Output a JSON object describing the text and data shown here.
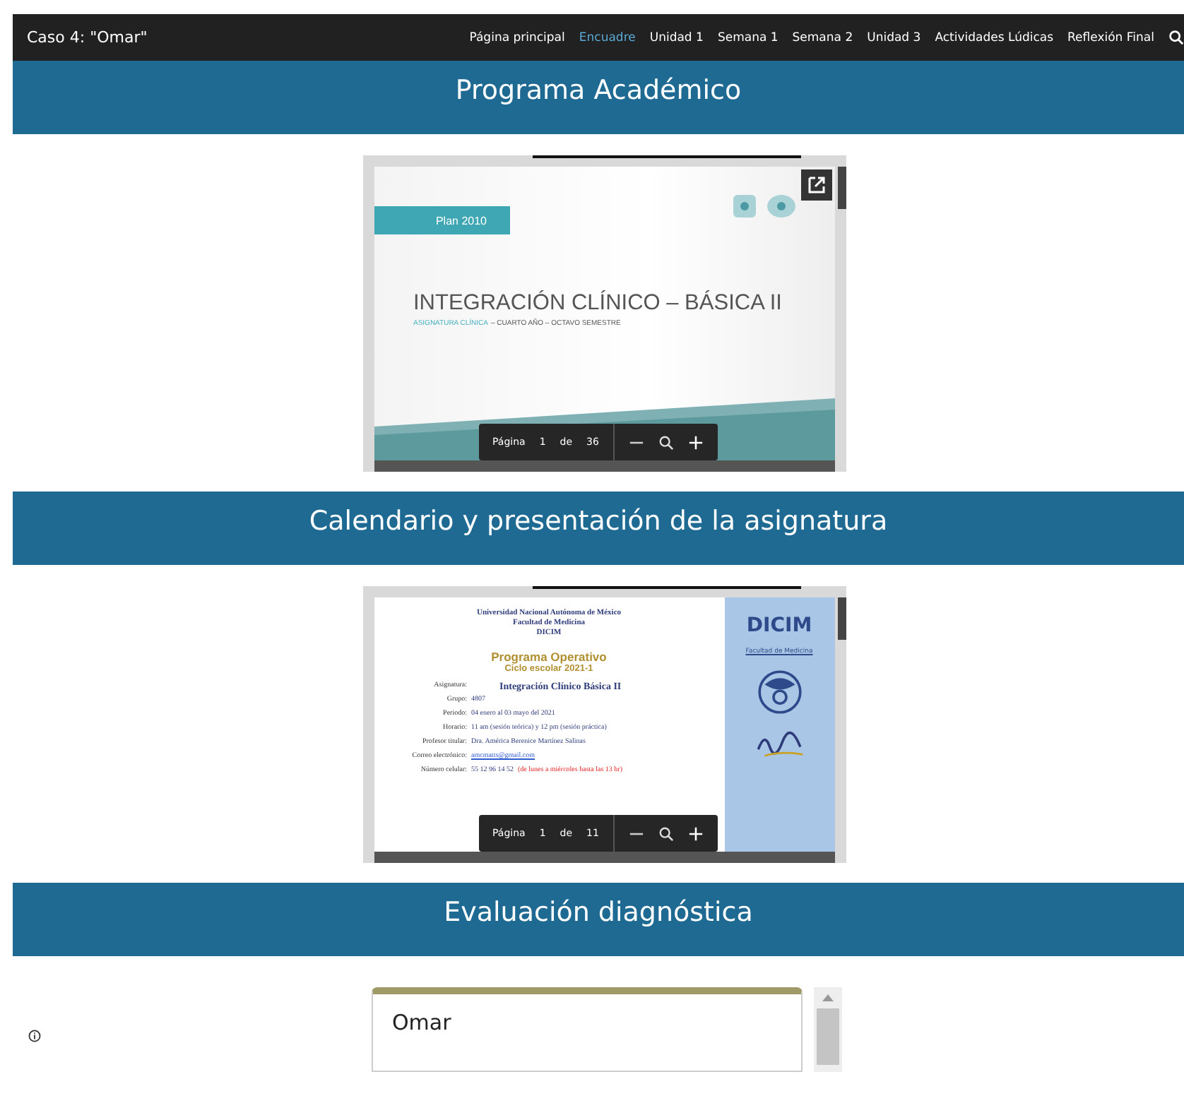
{
  "site_title": "Caso 4: \"Omar\"",
  "nav": [
    {
      "label": "Página principal",
      "selected": false
    },
    {
      "label": "Encuadre",
      "selected": true
    },
    {
      "label": "Unidad 1",
      "selected": false
    },
    {
      "label": "Semana 1",
      "selected": false
    },
    {
      "label": "Semana 2",
      "selected": false
    },
    {
      "label": "Unidad 3",
      "selected": false
    },
    {
      "label": "Actividades Lúdicas",
      "selected": false
    },
    {
      "label": "Reflexión Final",
      "selected": false
    }
  ],
  "sections": [
    {
      "heading": "Programa Académico",
      "viewer": {
        "kind": "slide",
        "page": "1",
        "of_label": "de",
        "page_label": "Página",
        "total": "36",
        "slide": {
          "badge": "Plan 2010",
          "title": "INTEGRACIÓN CLÍNICO – BÁSICA II",
          "subtitle_accent": "ASIGNATURA CLÍNICA",
          "subtitle_rest": "– CUARTO AÑO – OCTAVO SEMESTRE"
        }
      }
    },
    {
      "heading": "Calendario y presentación de la asignatura",
      "viewer": {
        "kind": "document",
        "page": "1",
        "of_label": "de",
        "page_label": "Página",
        "total": "11",
        "doc": {
          "header": [
            "Universidad Nacional Autónoma de México",
            "Facultad de Medicina",
            "DICIM"
          ],
          "title": "Programa Operativo",
          "cycle": "Ciclo escolar 2021-1",
          "fields": [
            {
              "label": "Asignatura:",
              "value": "Integración Clínico Básica II",
              "kind": "heading"
            },
            {
              "label": "Grupo:",
              "value": "4807",
              "kind": "plain"
            },
            {
              "label": "Periodo:",
              "value": "04 enero al 03 mayo del 2021",
              "kind": "plain"
            },
            {
              "label": "Horario:",
              "value": "11 am (sesión teórica) y 12 pm (sesión práctica)",
              "kind": "plain"
            },
            {
              "label": "Profesor titular:",
              "value": "Dra. América Berenice Martínez Salinas",
              "kind": "plain"
            },
            {
              "label": "Correo electrónico:",
              "value": "amcmatts@gmail.com",
              "kind": "link"
            },
            {
              "label": "Número celular:",
              "value": "55 12 96 14 52",
              "note": "(de lunes a miércoles hasta las 13 hr)",
              "kind": "plain"
            }
          ],
          "side_logo": "DICIM",
          "side_caption": "Facultad de Medicina"
        }
      }
    },
    {
      "heading": "Evaluación diagnóstica",
      "card": {
        "title": "Omar"
      }
    }
  ]
}
